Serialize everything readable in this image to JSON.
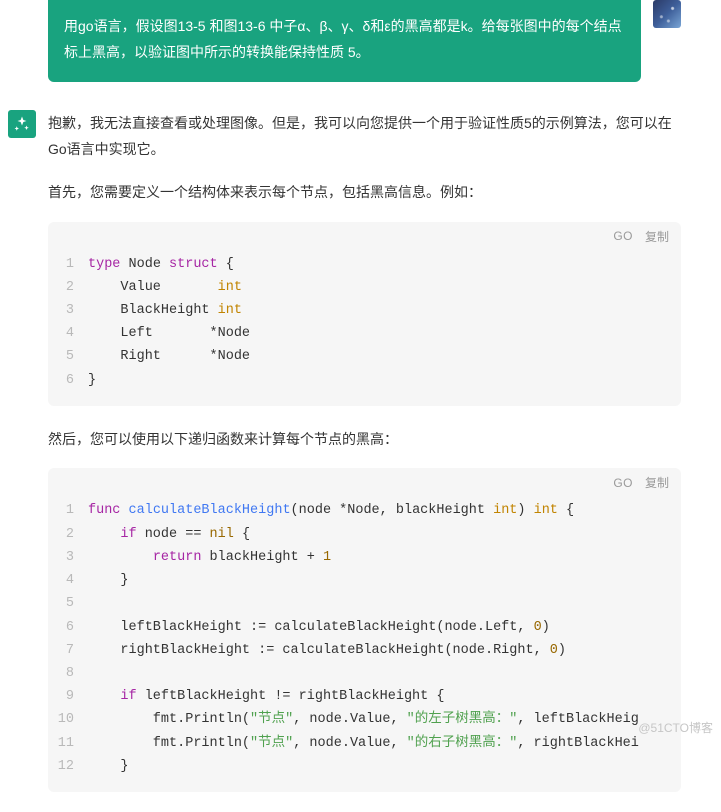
{
  "prompt": {
    "text": "用go语言，假设图13-5 和图13-6 中子α、β、γ、δ和ε的黑高都是k。给每张图中的每个结点标上黑高，以验证图中所示的转换能保持性质 5。"
  },
  "answer": {
    "para1": "抱歉，我无法直接查看或处理图像。但是，我可以向您提供一个用于验证性质5的示例算法，您可以在Go语言中实现它。",
    "para2": "首先，您需要定义一个结构体来表示每个节点，包括黑高信息。例如：",
    "para3": "然后，您可以使用以下递归函数来计算每个节点的黑高：",
    "code1": {
      "lang": "GO",
      "copy": "复制",
      "lines": [
        {
          "n": "1",
          "seg": [
            {
              "t": "type ",
              "c": "tok-kw"
            },
            {
              "t": "Node ",
              "c": ""
            },
            {
              "t": "struct",
              "c": "tok-kw"
            },
            {
              "t": " {",
              "c": ""
            }
          ]
        },
        {
          "n": "2",
          "seg": [
            {
              "t": "    Value       ",
              "c": ""
            },
            {
              "t": "int",
              "c": "tok-type"
            }
          ]
        },
        {
          "n": "3",
          "seg": [
            {
              "t": "    BlackHeight ",
              "c": ""
            },
            {
              "t": "int",
              "c": "tok-type"
            }
          ]
        },
        {
          "n": "4",
          "seg": [
            {
              "t": "    Left       *Node",
              "c": ""
            }
          ]
        },
        {
          "n": "5",
          "seg": [
            {
              "t": "    Right      *Node",
              "c": ""
            }
          ]
        },
        {
          "n": "6",
          "seg": [
            {
              "t": "}",
              "c": ""
            }
          ]
        }
      ]
    },
    "code2": {
      "lang": "GO",
      "copy": "复制",
      "lines": [
        {
          "n": "1",
          "seg": [
            {
              "t": "func ",
              "c": "tok-kw"
            },
            {
              "t": "calculateBlackHeight",
              "c": "tok-fn"
            },
            {
              "t": "(node *Node, blackHeight ",
              "c": ""
            },
            {
              "t": "int",
              "c": "tok-type"
            },
            {
              "t": ") ",
              "c": ""
            },
            {
              "t": "int",
              "c": "tok-type"
            },
            {
              "t": " {",
              "c": ""
            }
          ]
        },
        {
          "n": "2",
          "seg": [
            {
              "t": "    ",
              "c": ""
            },
            {
              "t": "if",
              "c": "tok-kw"
            },
            {
              "t": " node == ",
              "c": ""
            },
            {
              "t": "nil",
              "c": "tok-num"
            },
            {
              "t": " {",
              "c": ""
            }
          ]
        },
        {
          "n": "3",
          "seg": [
            {
              "t": "        ",
              "c": ""
            },
            {
              "t": "return",
              "c": "tok-kw"
            },
            {
              "t": " blackHeight + ",
              "c": ""
            },
            {
              "t": "1",
              "c": "tok-num"
            }
          ]
        },
        {
          "n": "4",
          "seg": [
            {
              "t": "    }",
              "c": ""
            }
          ]
        },
        {
          "n": "5",
          "seg": [
            {
              "t": "",
              "c": ""
            }
          ]
        },
        {
          "n": "6",
          "seg": [
            {
              "t": "    leftBlackHeight := calculateBlackHeight(node.Left, ",
              "c": ""
            },
            {
              "t": "0",
              "c": "tok-num"
            },
            {
              "t": ")",
              "c": ""
            }
          ]
        },
        {
          "n": "7",
          "seg": [
            {
              "t": "    rightBlackHeight := calculateBlackHeight(node.Right, ",
              "c": ""
            },
            {
              "t": "0",
              "c": "tok-num"
            },
            {
              "t": ")",
              "c": ""
            }
          ]
        },
        {
          "n": "8",
          "seg": [
            {
              "t": "",
              "c": ""
            }
          ]
        },
        {
          "n": "9",
          "seg": [
            {
              "t": "    ",
              "c": ""
            },
            {
              "t": "if",
              "c": "tok-kw"
            },
            {
              "t": " leftBlackHeight != rightBlackHeight {",
              "c": ""
            }
          ]
        },
        {
          "n": "10",
          "seg": [
            {
              "t": "        fmt.Println(",
              "c": ""
            },
            {
              "t": "\"节点\"",
              "c": "tok-str"
            },
            {
              "t": ", node.Value, ",
              "c": ""
            },
            {
              "t": "\"的左子树黑高：\"",
              "c": "tok-str"
            },
            {
              "t": ", leftBlackHeig",
              "c": ""
            }
          ]
        },
        {
          "n": "11",
          "seg": [
            {
              "t": "        fmt.Println(",
              "c": ""
            },
            {
              "t": "\"节点\"",
              "c": "tok-str"
            },
            {
              "t": ", node.Value, ",
              "c": ""
            },
            {
              "t": "\"的右子树黑高：\"",
              "c": "tok-str"
            },
            {
              "t": ", rightBlackHei",
              "c": ""
            }
          ]
        },
        {
          "n": "12",
          "seg": [
            {
              "t": "    }",
              "c": ""
            }
          ]
        }
      ]
    }
  },
  "watermark": "@51CTO博客"
}
